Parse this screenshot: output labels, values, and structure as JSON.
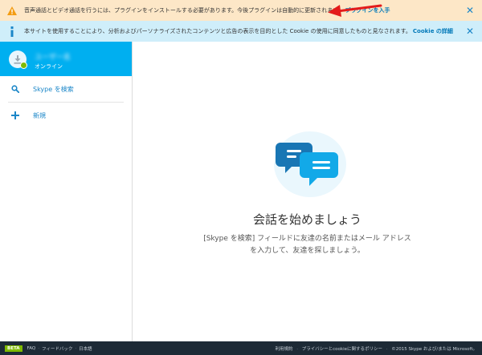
{
  "banners": {
    "warning": {
      "text": "音声通話とビデオ通話を行うには、プラグインをインストールする必要があります。今後プラグインは自動的に更新されます。",
      "link": "プラグインを入手",
      "close": "✕"
    },
    "info": {
      "text": "本サイトを使用することにより、分析およびパーソナライズされたコンテンツと広告の表示を目的とした Cookie の使用に同意したものと見なされます。",
      "link": "Cookie の詳細",
      "close": "✕"
    }
  },
  "profile": {
    "name": "ユーザー名",
    "status": "オンライン"
  },
  "sidebar": {
    "items": [
      {
        "label": "Skype を検索",
        "icon": "search-icon"
      },
      {
        "label": "新規",
        "icon": "plus-icon"
      }
    ]
  },
  "main": {
    "title": "会話を始めましょう",
    "subtitle_line1": "[Skype を検索] フィールドに友達の名前またはメール アドレス",
    "subtitle_line2": "を入力して、友達を探しましょう。"
  },
  "footer": {
    "beta": "BETA",
    "links": [
      "FAQ",
      "フィードバック",
      "日本語"
    ],
    "right_links": [
      "利用規約",
      "プライバシーとcookieに関するポリシー",
      "©2015 Skype および/または Microsoft。"
    ]
  },
  "colors": {
    "accent": "#00aff0",
    "warning_bg": "#fde7c7",
    "info_bg": "#cfeefa",
    "footer_bg": "#1d2a36",
    "online": "#7fba00"
  }
}
